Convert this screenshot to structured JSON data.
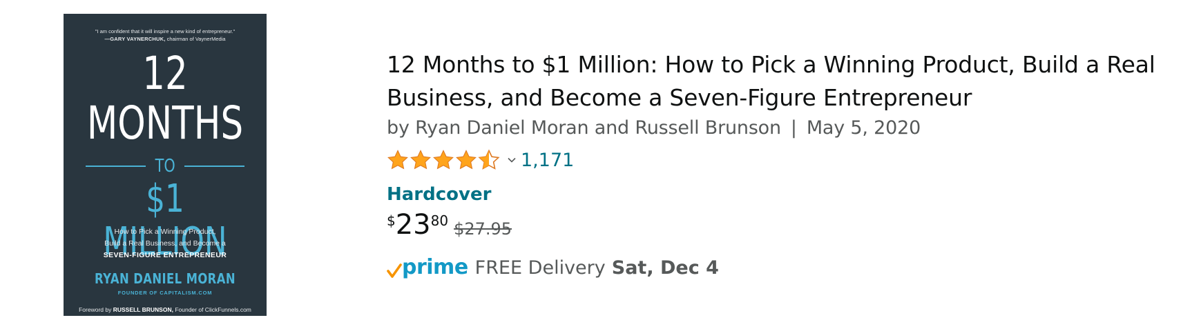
{
  "cover": {
    "quote": "\"I am confident that it will inspire a new kind of entrepreneur.\"",
    "quote_author": "—GARY VAYNERCHUK,",
    "quote_author_role": "chairman of VaynerMedia",
    "title_line1": "12",
    "title_line2": "MONTHS",
    "title_connector": "TO",
    "title_line3": "$1 MILLION",
    "subtitle_line1": "How to Pick a Winning Product,",
    "subtitle_line2": "Build a Real Business, and Become a",
    "subtitle_line3": "SEVEN-FIGURE ENTREPRENEUR",
    "author": "RYAN DANIEL MORAN",
    "author_role": "FOUNDER OF CAPITALISM.COM",
    "foreword_prefix": "Foreword by",
    "foreword_name": "RUSSELL BRUNSON,",
    "foreword_role": "Founder of ClickFunnels.com",
    "colors": {
      "background": "#29363f",
      "accent": "#4ab3d6"
    }
  },
  "product": {
    "title": "12 Months to $1 Million: How to Pick a Winning Product, Build a Real Business, and Become a Seven-Figure Entrepreneur",
    "byline": "by Ryan Daniel Moran and Russell Brunson",
    "separator": "|",
    "date": "May 5, 2020",
    "rating": {
      "value": 4.5,
      "out_of": 5,
      "count": "1,171"
    },
    "format": "Hardcover",
    "price": {
      "symbol": "$",
      "whole": "23",
      "fraction": "80",
      "list_price": "$27.95"
    },
    "delivery": {
      "badge": "prime",
      "text": "FREE Delivery",
      "date": "Sat, Dec 4"
    }
  },
  "icons": {
    "star": "star-icon",
    "half_star": "half-star-icon",
    "chevron": "chevron-down-icon",
    "prime_check": "prime-check-icon"
  },
  "colors": {
    "link": "#007185",
    "star": "#ffa41c",
    "text": "#0f1111",
    "secondary": "#565959",
    "prime": "#1399c6"
  }
}
